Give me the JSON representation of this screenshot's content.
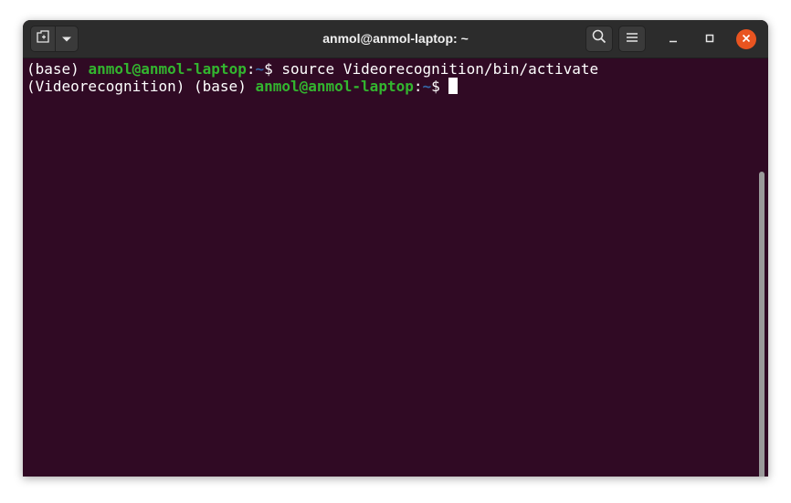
{
  "window": {
    "title": "anmol@anmol-laptop: ~"
  },
  "header": {
    "new_tab_icon": "new-tab-icon",
    "dropdown_icon": "chevron-down-icon",
    "search_icon": "search-icon",
    "menu_icon": "hamburger-menu-icon",
    "minimize_icon": "minimize-icon",
    "maximize_icon": "maximize-icon",
    "close_icon": "close-icon"
  },
  "terminal": {
    "lines": [
      {
        "prefix": "(base) ",
        "userhost": "anmol@anmol-laptop",
        "colon": ":",
        "path": "~",
        "prompt": "$ ",
        "command": "source Videorecognition/bin/activate"
      },
      {
        "prefix": "(Videorecognition) (base) ",
        "userhost": "anmol@anmol-laptop",
        "colon": ":",
        "path": "~",
        "prompt": "$ ",
        "command": ""
      }
    ]
  },
  "colors": {
    "terminal_bg": "#300a24",
    "userhost": "#33b52f",
    "path": "#3465a4",
    "close_button": "#e95420",
    "titlebar": "#2c2c2c"
  }
}
